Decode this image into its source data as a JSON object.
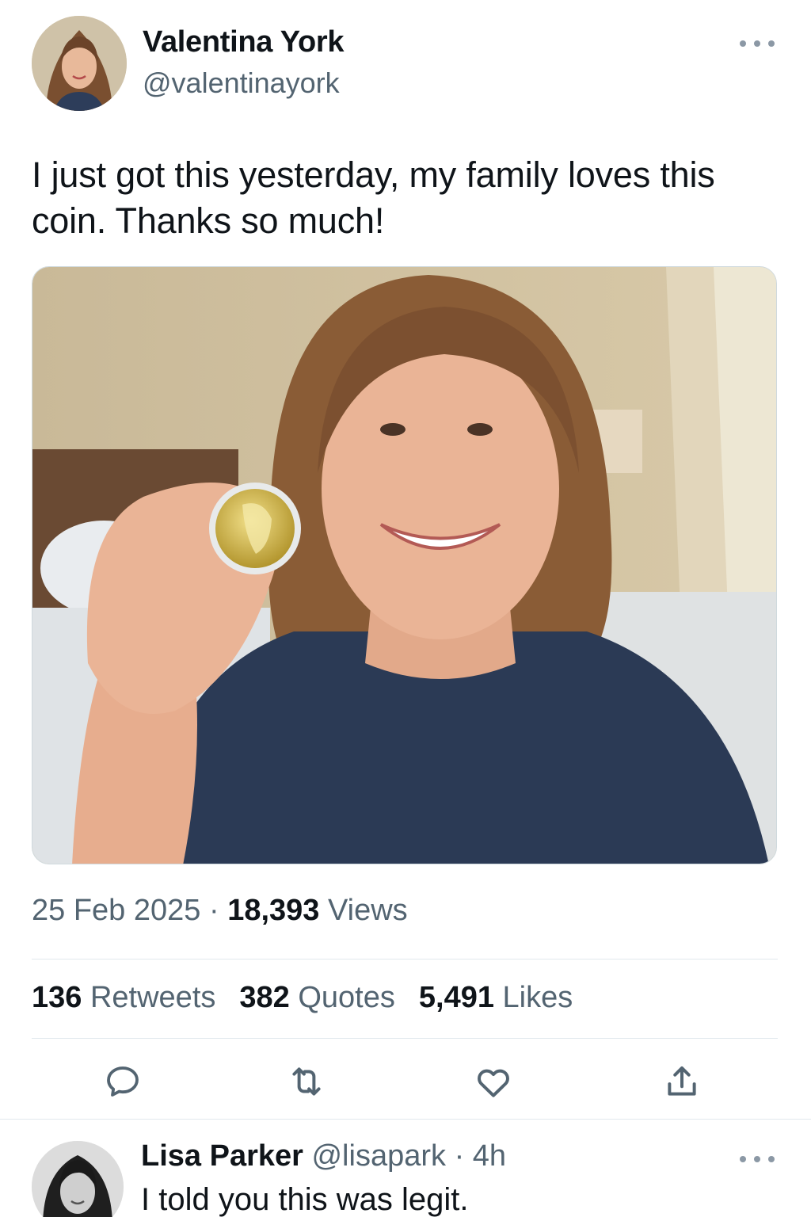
{
  "author": {
    "name": "Valentina York",
    "handle": "@valentinayork"
  },
  "tweet": {
    "text": "I just got this yesterday, my family loves this coin. Thanks so much!",
    "date": "25 Feb 2025",
    "separator": "·",
    "views_count": "18,393",
    "views_label": "Views"
  },
  "stats": {
    "retweets_count": "136",
    "retweets_label": "Retweets",
    "quotes_count": "382",
    "quotes_label": "Quotes",
    "likes_count": "5,491",
    "likes_label": "Likes"
  },
  "actions": {
    "reply_icon": "reply-icon",
    "retweet_icon": "retweet-icon",
    "like_icon": "heart-icon",
    "share_icon": "share-icon"
  },
  "reply": {
    "name": "Lisa Parker",
    "handle": "@lisapark",
    "separator": "·",
    "time": "4h",
    "text": "I told you this was legit."
  },
  "colors": {
    "text_primary": "#0f1419",
    "text_secondary": "#536471",
    "divider": "#e1e8ed",
    "icon": "#536471"
  }
}
